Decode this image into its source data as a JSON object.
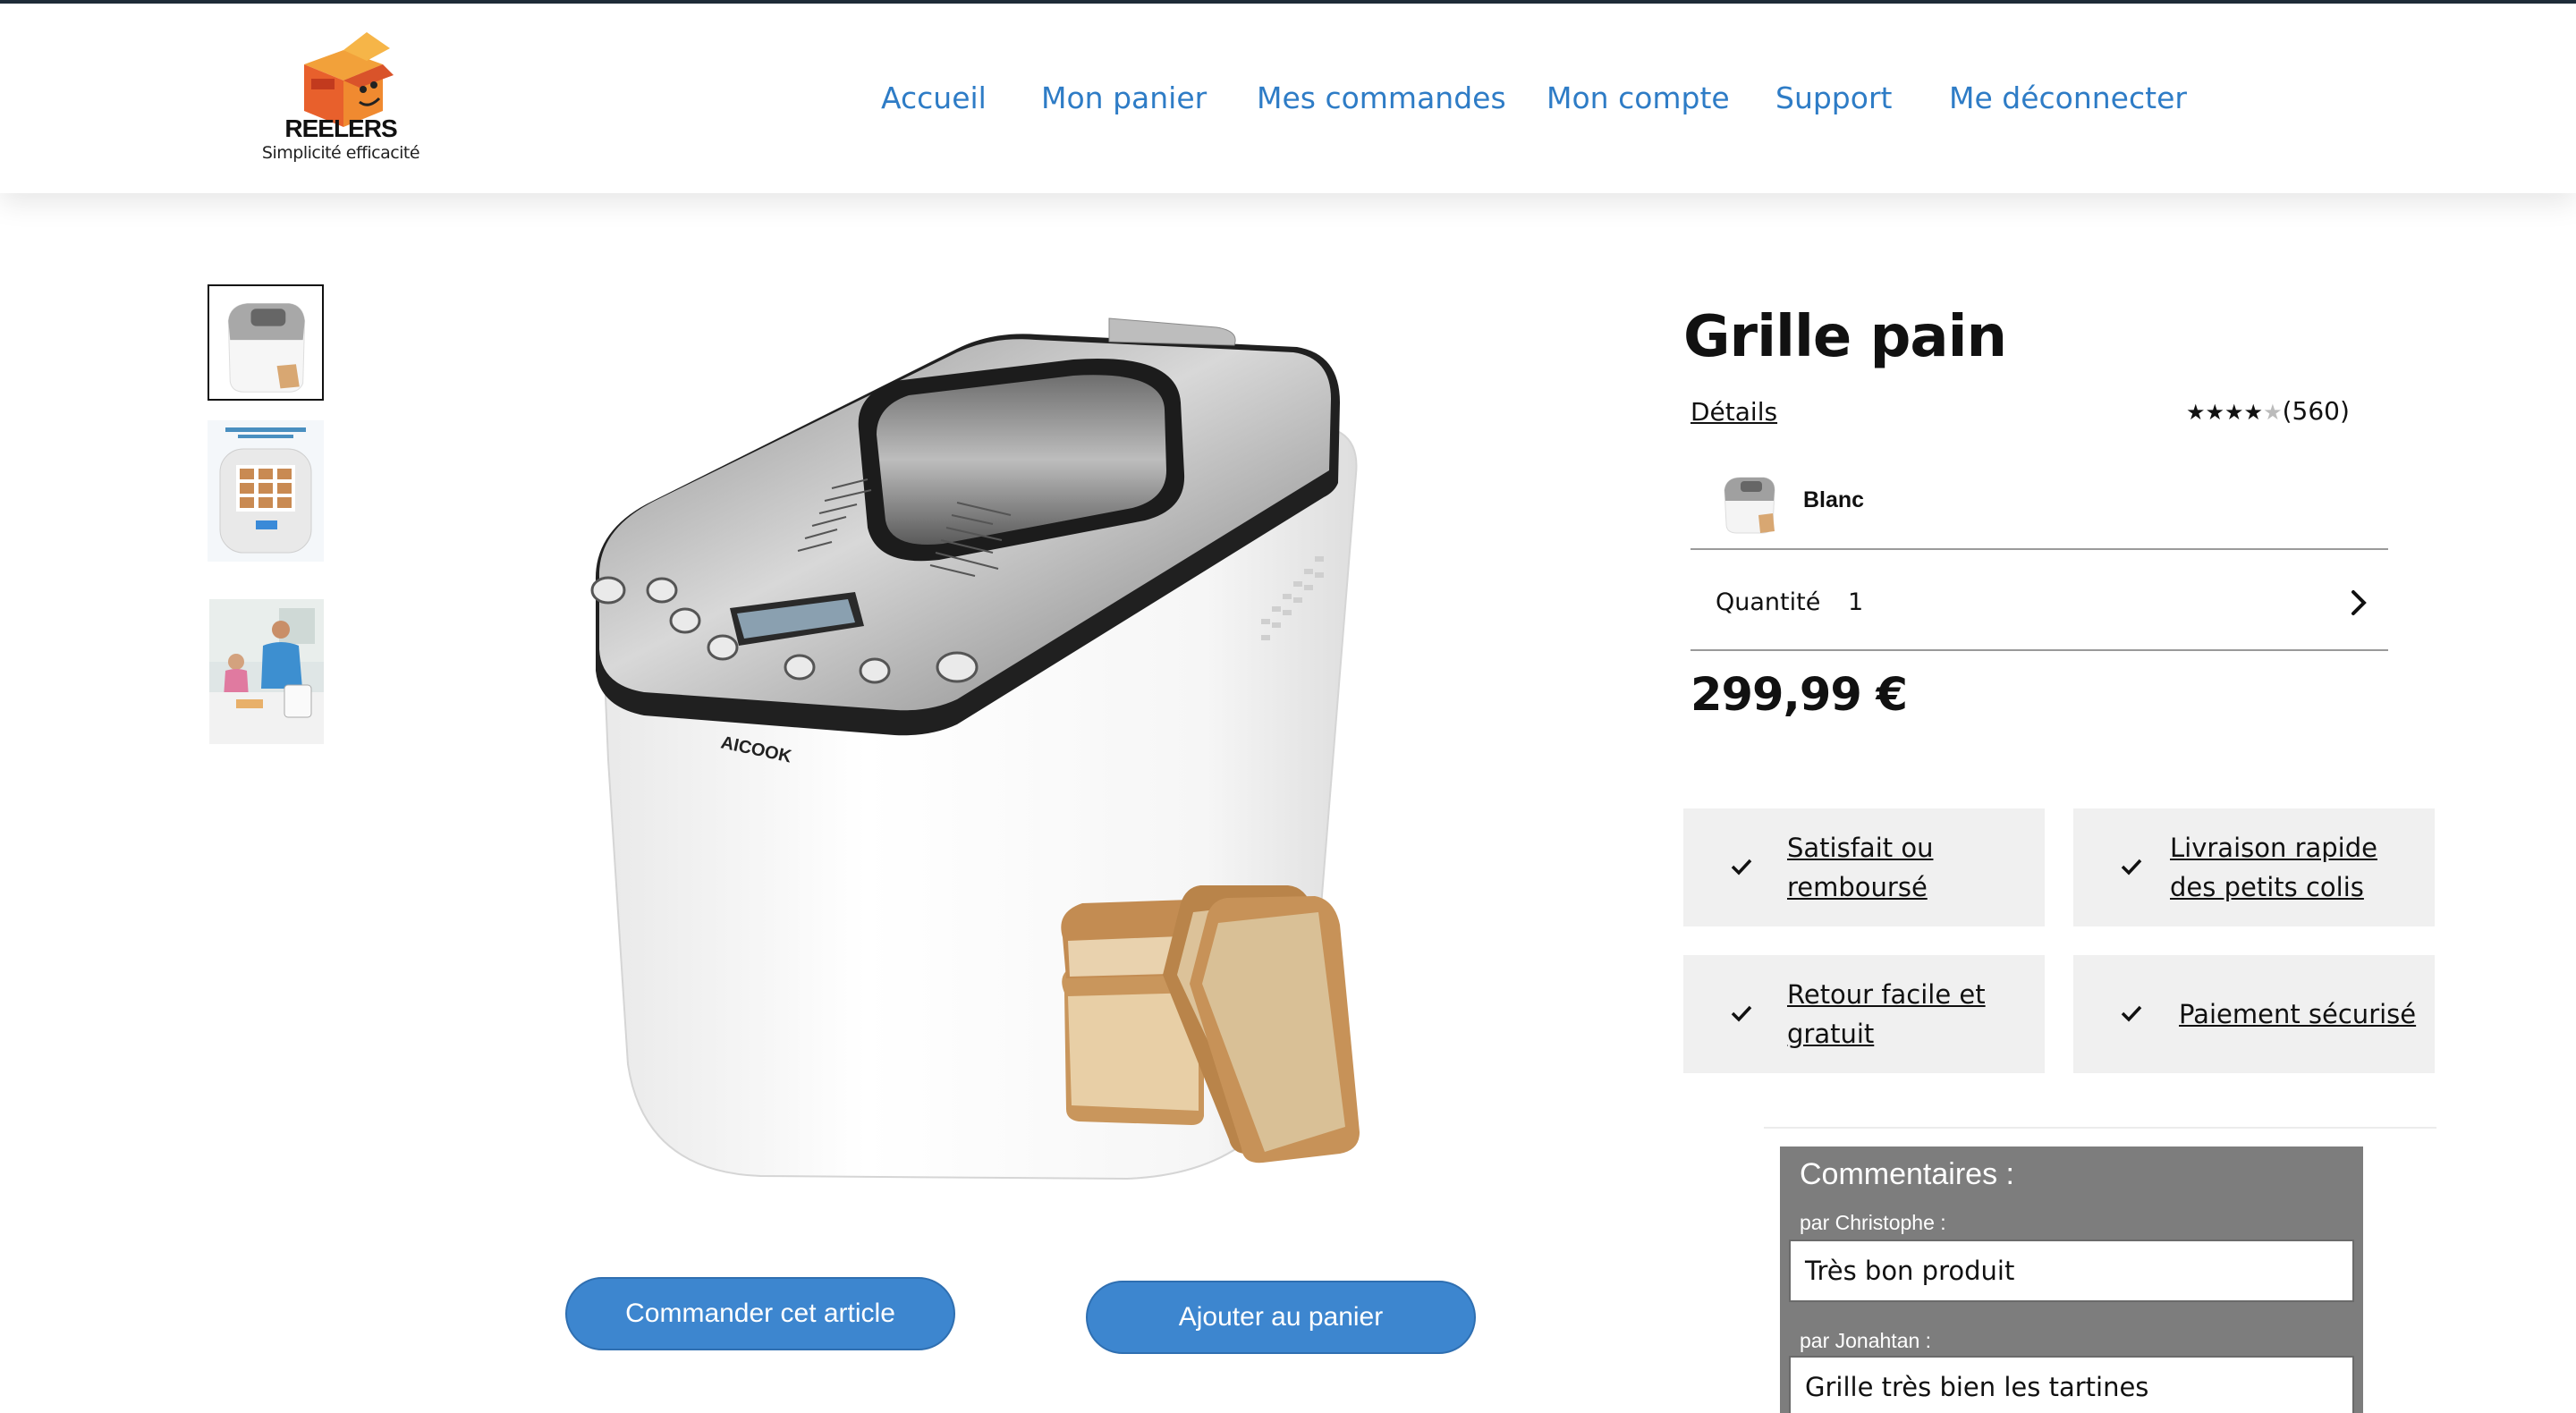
{
  "brand": {
    "name": "REELERS",
    "tagline": "Simplicité efficacité"
  },
  "nav": {
    "items": [
      "Accueil",
      "Mon panier",
      "Mes commandes",
      "Mon compte",
      "Support",
      "Me déconnecter"
    ]
  },
  "product": {
    "title": "Grille pain",
    "details_link": "Détails",
    "rating": {
      "stars": 4,
      "max": 5,
      "count": "(560)"
    },
    "variant": {
      "label": "Blanc"
    },
    "quantity": {
      "label": "Quantité",
      "value": "1"
    },
    "price": "299,99 €",
    "appliance_brand": "AICOOK"
  },
  "features": [
    "Satisfait ou remboursé",
    "Livraison rapide des petits colis",
    "Retour facile et gratuit",
    "Paiement sécurisé"
  ],
  "actions": {
    "order": "Commander cet article",
    "add_to_cart": "Ajouter au panier"
  },
  "comments": {
    "title": "Commentaires :",
    "items": [
      {
        "author": "par Christophe :",
        "text": "Très bon produit"
      },
      {
        "author": "par Jonahtan :",
        "text": "Grille très bien les tartines"
      }
    ]
  },
  "colors": {
    "nav_link": "#2e7cc6",
    "button": "#3d86cf",
    "feature_bg": "#f0f0f0",
    "comments_bg": "#7d7d7d"
  }
}
